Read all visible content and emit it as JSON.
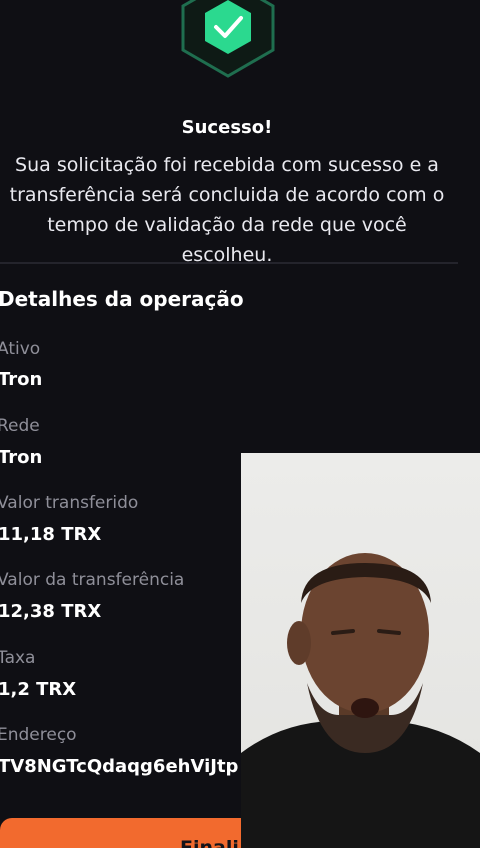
{
  "status": {
    "title": "Sucesso!",
    "message": "Sua solicitação foi recebida com sucesso e a transferência será concluida de acordo com o tempo de validação da rede que você escolheu."
  },
  "details": {
    "heading": "Detalhes da operação",
    "items": [
      {
        "label": "Ativo",
        "value": "Tron"
      },
      {
        "label": "Rede",
        "value": "Tron"
      },
      {
        "label": "Valor transferido",
        "value": "11,18 TRX"
      },
      {
        "label": "Valor da transferência",
        "value": "12,38 TRX"
      },
      {
        "label": "Taxa",
        "value": "1,2 TRX"
      },
      {
        "label": "Endereço",
        "value": "TV8NGTcQdaqg6ehViJtp"
      }
    ]
  },
  "actions": {
    "finish_label": "Finali"
  },
  "colors": {
    "background": "#0f0f14",
    "success_green": "#2bd98f",
    "badge_border": "#1f6e4f",
    "accent_orange": "#f26a2e",
    "label_gray": "#8f8f99"
  },
  "icons": {
    "status": "check-icon"
  }
}
